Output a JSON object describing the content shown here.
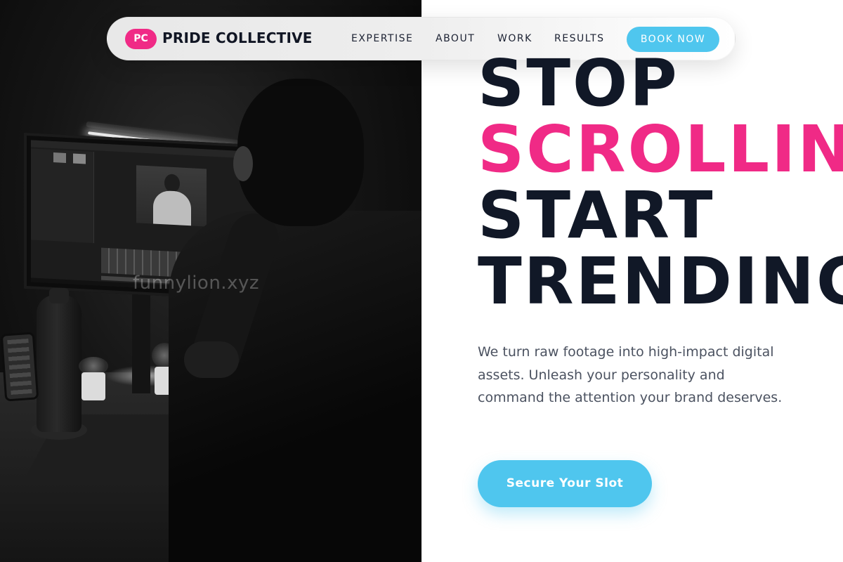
{
  "brand": {
    "badge": "PC",
    "name": "PRIDE COLLECTIVE",
    "badge_color": "#f02a86"
  },
  "nav": {
    "links": [
      "EXPERTISE",
      "ABOUT",
      "WORK",
      "RESULTS"
    ],
    "cta": "BOOK NOW",
    "cta_color": "#4fc6ee"
  },
  "hero": {
    "headline": [
      "STOP",
      "SCROLLING",
      "START",
      "TRENDING"
    ],
    "highlight_color": "#f02a86",
    "text_color": "#111827",
    "subtext": "We turn raw footage into high-impact digital assets. Unleash your personality and command the attention your brand deserves.",
    "cta": "Secure Your Slot"
  },
  "photo": {
    "watermark": "funnylion.xyz"
  }
}
